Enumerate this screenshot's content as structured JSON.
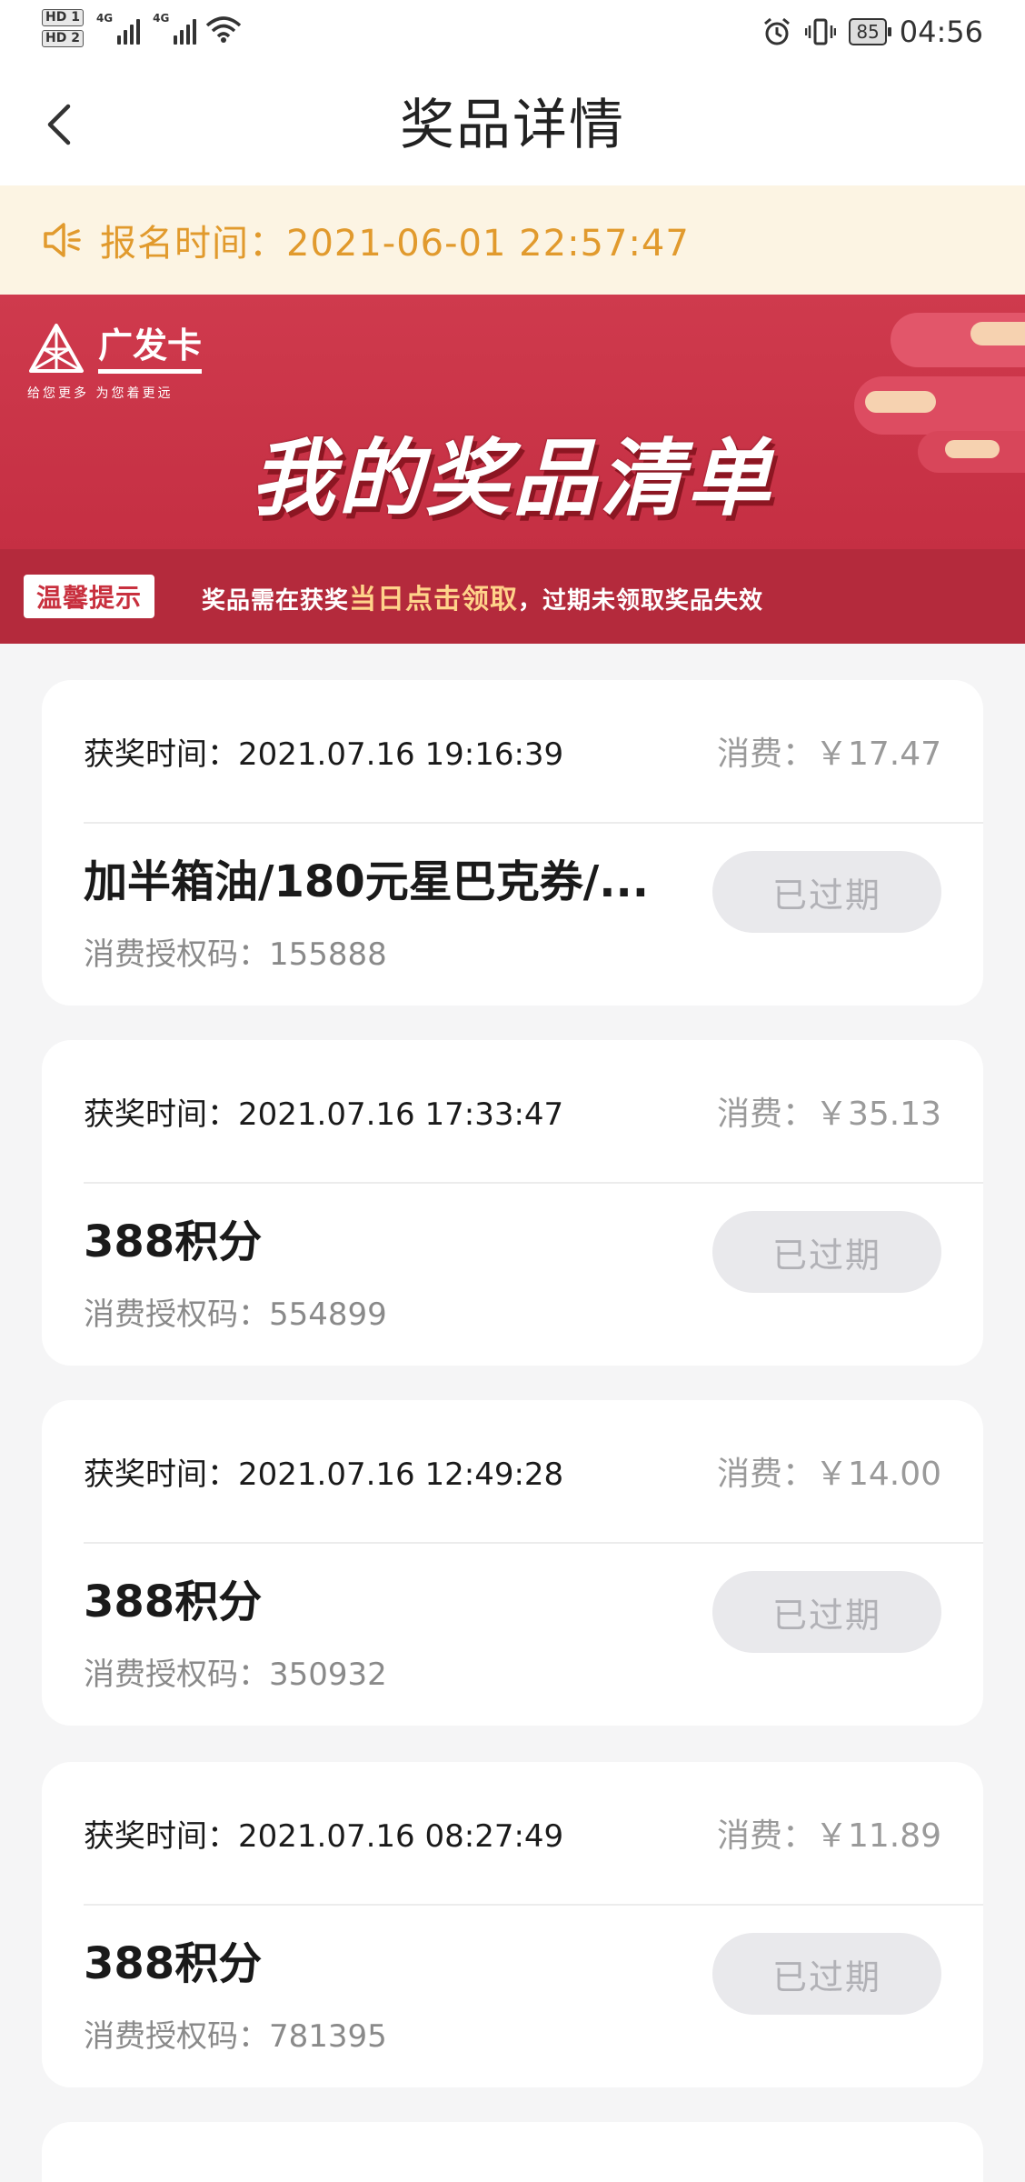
{
  "status_bar": {
    "sim1": "HD 1",
    "sim2": "HD 2",
    "net1": "4G",
    "net2": "4G",
    "battery": "85",
    "time": "04:56",
    "icons": [
      "hd-icon",
      "signal-icon",
      "signal-icon",
      "wifi-icon",
      "alarm-icon",
      "vibrate-icon",
      "battery-icon"
    ]
  },
  "nav": {
    "title": "奖品详情",
    "back_icon": "chevron-left-icon"
  },
  "notice": {
    "icon": "speaker-icon",
    "text": "报名时间：2021-06-01 22:57:47"
  },
  "banner": {
    "logo_name": "广发卡",
    "logo_slogan": "给您更多  为您着更远",
    "title": "我的奖品清单",
    "tip_badge": "温馨提示",
    "tip_before": "奖品需在获奖",
    "tip_highlight": "当日点击领取",
    "tip_after": "，过期未领取奖品失效"
  },
  "prizes": [
    {
      "award_time": "获奖时间：2021.07.16 19:16:39",
      "spend": "消费：￥17.47",
      "name": "加半箱油/180元星巴克券/...",
      "auth_code": "消费授权码：155888",
      "status": "已过期"
    },
    {
      "award_time": "获奖时间：2021.07.16 17:33:47",
      "spend": "消费：￥35.13",
      "name": "388积分",
      "auth_code": "消费授权码：554899",
      "status": "已过期"
    },
    {
      "award_time": "获奖时间：2021.07.16 12:49:28",
      "spend": "消费：￥14.00",
      "name": "388积分",
      "auth_code": "消费授权码：350932",
      "status": "已过期"
    },
    {
      "award_time": "获奖时间：2021.07.16 08:27:49",
      "spend": "消费：￥11.89",
      "name": "388积分",
      "auth_code": "消费授权码：781395",
      "status": "已过期"
    }
  ],
  "colors": {
    "notice_text": "#e19a2d",
    "notice_bg": "#fcf4e3",
    "banner_red": "#c93346",
    "expired_btn_bg": "#e9e9ec",
    "expired_btn_text": "#b1b1b6"
  }
}
